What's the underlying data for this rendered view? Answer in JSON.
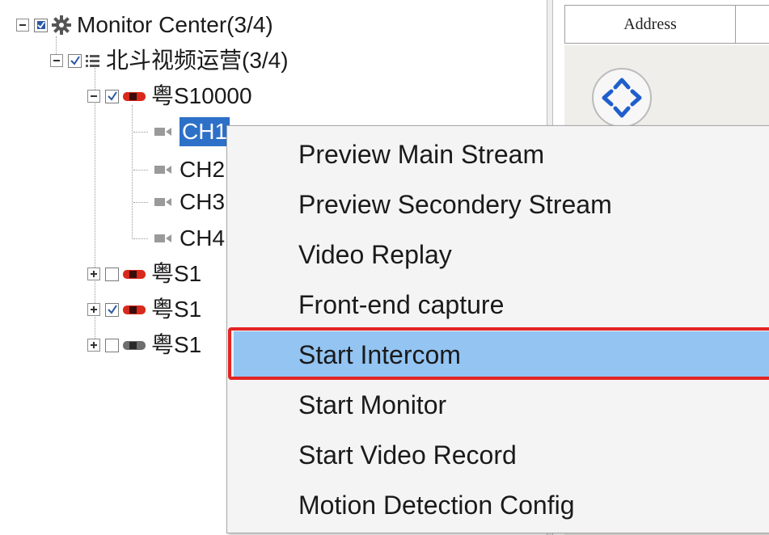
{
  "tree": {
    "root": {
      "label": "Monitor Center(3/4)",
      "checked": "partial",
      "icon": "gear-icon"
    },
    "group": {
      "label": "北斗视频运营(3/4)",
      "checked": true,
      "icon": "list-icon"
    },
    "vehicles": [
      {
        "label": "粤S10000",
        "checked": true,
        "icon": "car-icon",
        "status_color": "#d8291c",
        "expanded": true
      },
      {
        "label": "粤S1",
        "checked": false,
        "icon": "car-icon",
        "status_color": "#d8291c",
        "expanded": false
      },
      {
        "label": "粤S1",
        "checked": true,
        "icon": "car-icon",
        "status_color": "#d8291c",
        "expanded": false
      },
      {
        "label": "粤S1",
        "checked": false,
        "icon": "car-icon",
        "status_color": "#6e6e6e",
        "expanded": false
      }
    ],
    "channels": [
      {
        "label": "CH1",
        "selected": true,
        "icon": "camera-icon"
      },
      {
        "label": "CH2",
        "selected": false,
        "icon": "camera-icon"
      },
      {
        "label": "CH3",
        "selected": false,
        "icon": "camera-icon"
      },
      {
        "label": "CH4",
        "selected": false,
        "icon": "camera-icon"
      }
    ]
  },
  "right_panel": {
    "table_header": {
      "address": "Address",
      "next": ""
    },
    "map": {
      "pan_control": "pan-arrows-icon",
      "partial_label": ""
    }
  },
  "context_menu": {
    "items": [
      {
        "label": "Preview Main Stream"
      },
      {
        "label": "Preview Secondery Stream"
      },
      {
        "label": "Video Replay"
      },
      {
        "label": "Front-end capture"
      },
      {
        "label": "Start Intercom",
        "highlighted": true
      },
      {
        "label": "Start Monitor"
      },
      {
        "label": "Start Video Record"
      },
      {
        "label": "Motion Detection Config"
      }
    ]
  },
  "colors": {
    "selection": "#2d70c8",
    "menu_highlight": "#93c4f2",
    "annotation_frame": "#e32424",
    "car_active": "#d8291c",
    "car_offline": "#6e6e6e"
  }
}
